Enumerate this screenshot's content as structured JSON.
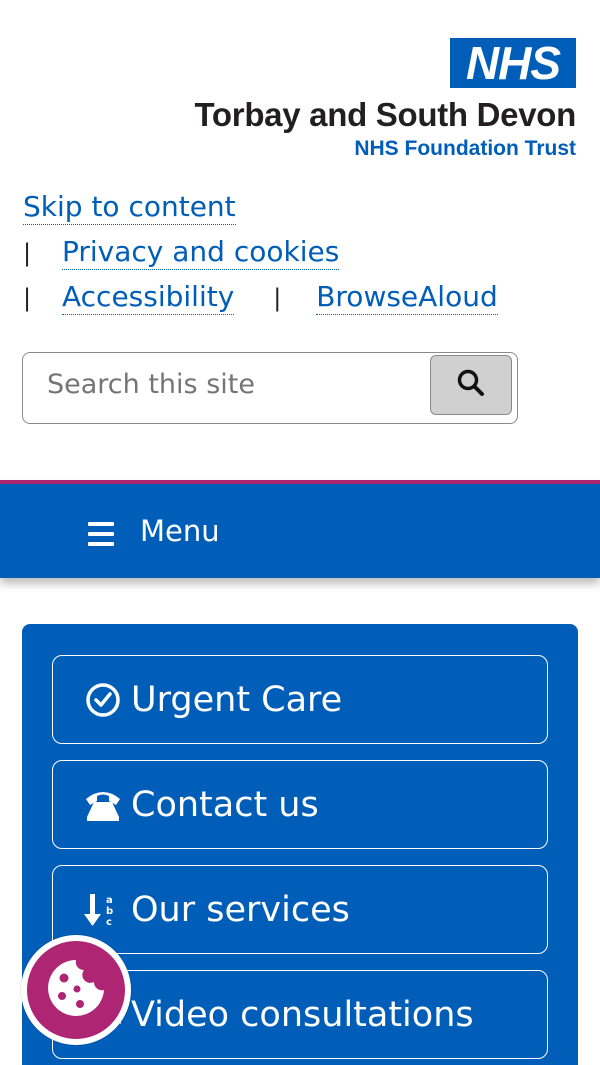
{
  "header": {
    "logo_text": "NHS",
    "trust_name": "Torbay and South Devon",
    "trust_subtitle": "NHS Foundation Trust",
    "brand_color": "#005eb8"
  },
  "utility_links": {
    "skip": "Skip to content",
    "privacy": "Privacy and cookies",
    "accessibility": "Accessibility",
    "browsealoud": "BrowseAloud",
    "separator": "|"
  },
  "search": {
    "placeholder": "Search this site",
    "button_icon": "search-icon"
  },
  "nav": {
    "menu_label": "Menu",
    "menu_icon": "hamburger-icon",
    "accent_color": "#ae2573"
  },
  "quick_links": [
    {
      "label": "Urgent Care",
      "icon": "clock-check-icon"
    },
    {
      "label": "Contact us",
      "icon": "phone-icon"
    },
    {
      "label": "Our services",
      "icon": "sort-alpha-icon"
    },
    {
      "label": "Video consultations",
      "icon": "video-icon"
    }
  ],
  "cookie_button": {
    "icon": "cookie-icon",
    "color": "#ae2573"
  }
}
